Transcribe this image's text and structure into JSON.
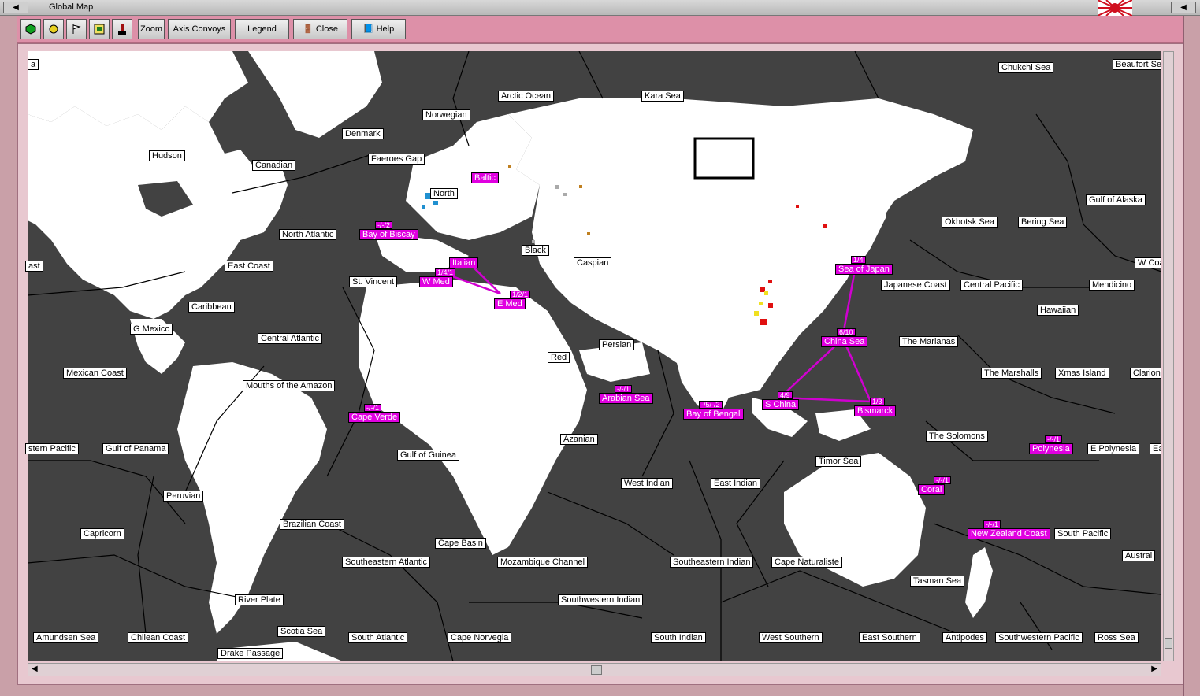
{
  "window": {
    "title": "Global Map"
  },
  "toolbar": {
    "zoom_label": "Zoom",
    "axis_convoys_label": "Axis Convoys",
    "legend_label": "Legend",
    "close_label": "Close",
    "help_label": "Help"
  },
  "colors": {
    "sea": "#424242",
    "land": "#ffffff",
    "zone": "#e000e0",
    "toolbar": "#dd90a8"
  },
  "sea_labels": [
    "Arctic Ocean",
    "Kara Sea",
    "Chukchi Sea",
    "Beaufort Sea",
    "Norwegian",
    "Denmark",
    "Hudson",
    "Faeroes Gap",
    "Canadian",
    "North",
    "North Atlantic",
    "Okhotsk Sea",
    "Bering Sea",
    "Gulf of Alaska",
    "East Coast",
    "Black",
    "Caspian",
    "St. Vincent",
    "Japanese Coast",
    "Central Pacific",
    "Mendicino",
    "W Coast",
    "Caribbean",
    "G Mexico",
    "Central Atlantic",
    "Persian",
    "Hawaiian",
    "The Marianas",
    "Red",
    "Mexican Coast",
    "The Marshalls",
    "Xmas Island",
    "Clarion",
    "Mouths of the Amazon",
    "Azanian",
    "The Solomons",
    "stern Pacific",
    "Gulf of Panama",
    "Gulf of Guinea",
    "E Polynesia",
    "Timor Sea",
    "West Indian",
    "East Indian",
    "Peruvian",
    "Brazilian Coast",
    "Capricorn",
    "Cape Basin",
    "South Pacific",
    "Austral",
    "Southeastern Atlantic",
    "Mozambique Channel",
    "Southeastern Indian",
    "Cape Naturaliste",
    "Tasman Sea",
    "River Plate",
    "Southwestern Indian",
    "Amundsen Sea",
    "Chilean Coast",
    "Scotia Sea",
    "South Atlantic",
    "Cape Norvegia",
    "South Indian",
    "West Southern",
    "East Southern",
    "Antipodes",
    "Southwestern Pacific",
    "Ross Sea",
    "Drake Passage",
    "ast",
    "a",
    "Ea"
  ],
  "zones": [
    {
      "name": "Baltic",
      "stat": ""
    },
    {
      "name": "Bay of Biscay",
      "stat": "-/-/2"
    },
    {
      "name": "Italian",
      "stat": ""
    },
    {
      "name": "W Med",
      "stat": "1/4/1"
    },
    {
      "name": "E Med",
      "stat": "1/2/1"
    },
    {
      "name": "Sea of Japan",
      "stat": "1/4"
    },
    {
      "name": "China Sea",
      "stat": "6/10"
    },
    {
      "name": "Arabian Sea",
      "stat": "-/-/1"
    },
    {
      "name": "Bay of Bengal",
      "stat": "-/5/-/2"
    },
    {
      "name": "S China",
      "stat": "4/9"
    },
    {
      "name": "Bismarck",
      "stat": "1/3"
    },
    {
      "name": "Cape Verde",
      "stat": "-/-/1"
    },
    {
      "name": "Polynesia",
      "stat": "-/-/1"
    },
    {
      "name": "Coral",
      "stat": "-/-/1"
    },
    {
      "name": "New Zealand Coast",
      "stat": "-/-/1"
    }
  ]
}
